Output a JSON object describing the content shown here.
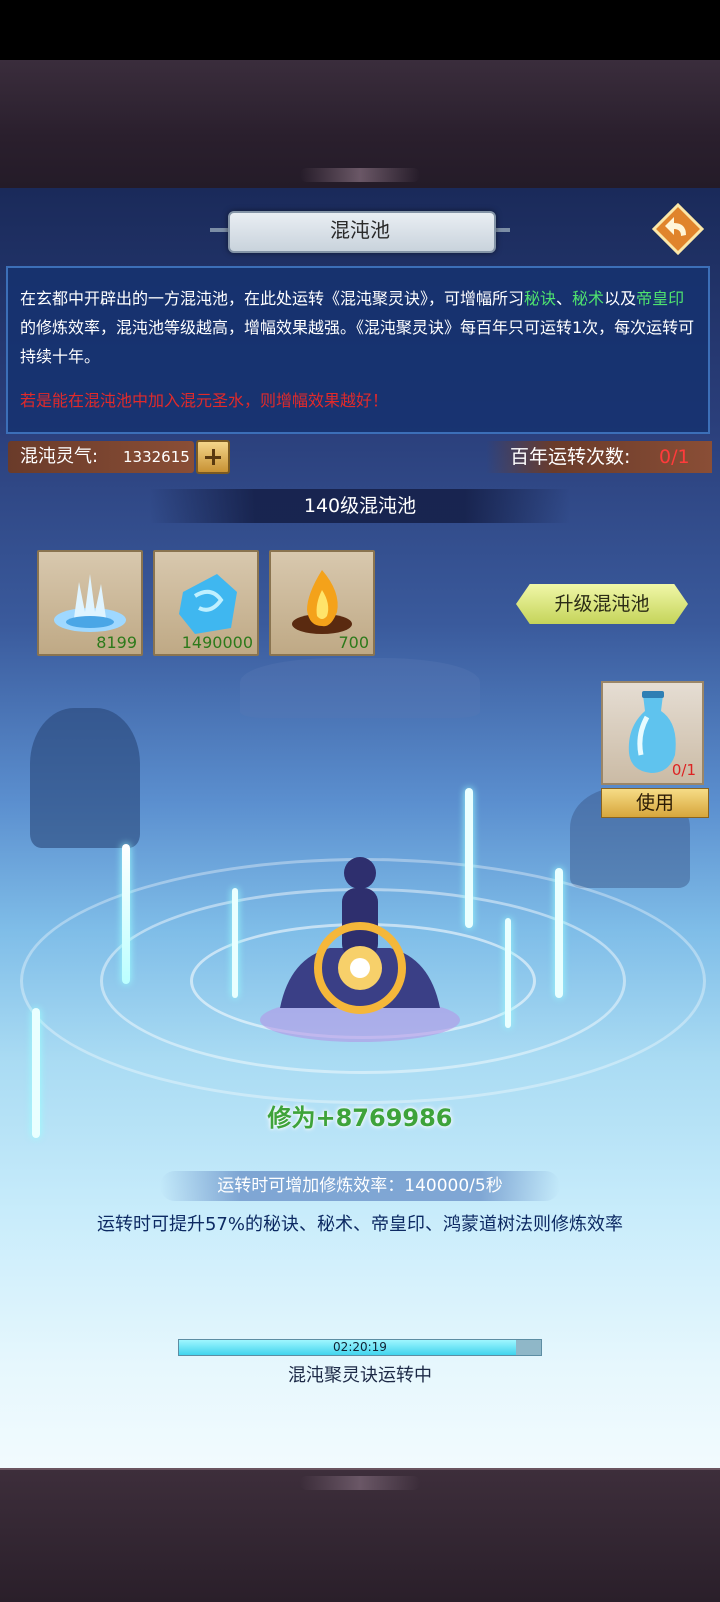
{
  "header": {
    "title": "混沌池"
  },
  "description": {
    "part1": "在玄都中开辟出的一方混沌池，在此处运转《混沌聚灵诀》，可增幅所习",
    "g1": "秘诀",
    "part2": "、",
    "g2": "秘术",
    "part3": "以及",
    "g3": "帝皇印",
    "part4": "的修炼效率，混沌池等级越高，增幅效果越强。《混沌聚灵诀》每百年只可运转1次，每次运转可持续十年。",
    "warning": "若是能在混沌池中加入混元圣水，则增幅效果越好！"
  },
  "resources": {
    "lingqi_label": "混沌灵气:",
    "lingqi_value": "1332615",
    "count_label": "百年运转次数:",
    "count_value": "0/1"
  },
  "pool": {
    "level_label": "140级混沌池"
  },
  "materials": [
    {
      "icon": "spirit-water-icon",
      "count": "8199"
    },
    {
      "icon": "blue-crystal-icon",
      "count": "1490000"
    },
    {
      "icon": "flame-icon",
      "count": "700"
    }
  ],
  "upgrade": {
    "label": "升级混沌池"
  },
  "holy_water": {
    "icon": "water-bottle-icon",
    "count": "0/1",
    "use_label": "使用"
  },
  "stats": {
    "xiuwei": "修为+8769986",
    "rate": "运转时可增加修炼效率：140000/5秒",
    "boost": "运转时可提升57%的秘诀、秘术、帝皇印、鸿蒙道树法则修炼效率"
  },
  "progress": {
    "time": "02:20:19",
    "fraction": 0.93,
    "status": "混沌聚灵诀运转中"
  },
  "colors": {
    "highlight_green": "#4fe36f",
    "warning_red": "#e12a2a",
    "count_red": "#ff3b3b",
    "xiuwei_green": "#3ea33a"
  }
}
